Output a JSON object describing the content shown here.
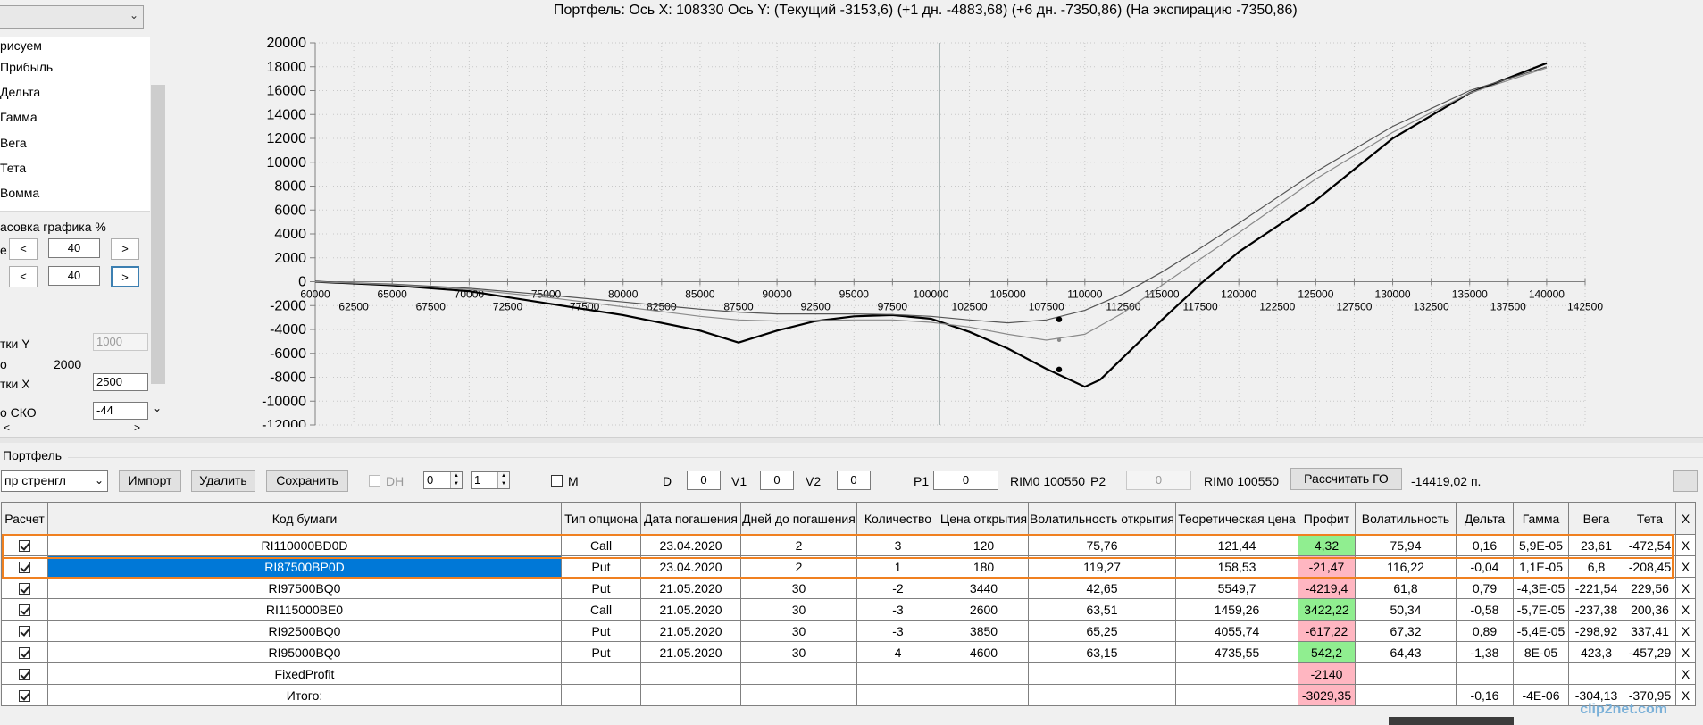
{
  "left_panel": {
    "dropdown_value": "",
    "items": [
      "рисуем",
      "Прибыль",
      "Дельта",
      "Гамма",
      "Вега",
      "Тета",
      "Вомма"
    ],
    "scale_title": "асовка графика %",
    "scale_row1_label": "е",
    "scale_row1_value": "40",
    "scale_row2_value": "40",
    "btn_dec": "<",
    "btn_inc": ">",
    "grid_y_label": "тки Y",
    "grid_y_value": "1000",
    "o_label": "о",
    "o_value": "2000",
    "grid_x_label": "тки X",
    "grid_x_value": "2500",
    "sko_label": "о СКО",
    "sko_value": "-44",
    "hscroll_left": "<",
    "hscroll_right": ">",
    "scroll_down": "⌄"
  },
  "chart": {
    "title": "Портфель: Ось X: 108330 Ось Y:  (Текущий -3153,6)  (+1 дн. -4883,68)  (+6 дн. -7350,86)  (На экспирацию -7350,86)"
  },
  "chart_data": {
    "type": "line",
    "title": "Портфель: Ось X: 108330 Ось Y:  (Текущий -3153,6)  (+1 дн. -4883,68)  (+6 дн. -7350,86)  (На экспирацию -7350,86)",
    "xlim": [
      60000,
      142500
    ],
    "ylim": [
      -12000,
      20000
    ],
    "x_ticks_upper": [
      60000,
      65000,
      70000,
      75000,
      80000,
      85000,
      90000,
      95000,
      100000,
      105000,
      110000,
      115000,
      120000,
      125000,
      130000,
      135000,
      140000
    ],
    "x_ticks_lower": [
      62500,
      67500,
      72500,
      77500,
      82500,
      87500,
      92500,
      97500,
      102500,
      107500,
      112500,
      117500,
      122500,
      127500,
      132500,
      137500,
      142500
    ],
    "y_ticks": [
      20000,
      18000,
      16000,
      14000,
      12000,
      10000,
      8000,
      6000,
      4000,
      2000,
      0,
      -2000,
      -4000,
      -6000,
      -8000,
      -10000,
      -12000
    ],
    "vertical_line_x": 100550,
    "grid": true,
    "series": [
      {
        "color": "#000000",
        "width": 2.2,
        "x": [
          60000,
          65000,
          70000,
          75000,
          80000,
          85000,
          87500,
          90000,
          92500,
          95000,
          97500,
          100000,
          102500,
          105000,
          107500,
          110000,
          111000,
          115000,
          117500,
          120000,
          125000,
          130000,
          135000,
          140000
        ],
        "y": [
          0,
          -300,
          -800,
          -1800,
          -2800,
          -4100,
          -5100,
          -4100,
          -3300,
          -2900,
          -2800,
          -3100,
          -4200,
          -5600,
          -7300,
          -8800,
          -8200,
          -3200,
          -200,
          2500,
          6800,
          12000,
          15800,
          18300
        ]
      },
      {
        "color": "#555555",
        "width": 1.2,
        "x": [
          60000,
          65000,
          70000,
          75000,
          80000,
          85000,
          87500,
          90000,
          92500,
          95000,
          97500,
          100000,
          102500,
          105000,
          107500,
          110000,
          112500,
          115000,
          117500,
          120000,
          125000,
          130000,
          135000,
          140000
        ],
        "y": [
          0,
          -200,
          -550,
          -1100,
          -1700,
          -2300,
          -2550,
          -2700,
          -2700,
          -2700,
          -2750,
          -2900,
          -3200,
          -3450,
          -3200,
          -2400,
          -1000,
          800,
          2800,
          4900,
          9200,
          13000,
          16000,
          18000
        ]
      },
      {
        "color": "#8a8a8a",
        "width": 1.2,
        "x": [
          60000,
          65000,
          70000,
          75000,
          80000,
          85000,
          87500,
          90000,
          92500,
          95000,
          97500,
          100000,
          102500,
          105000,
          107500,
          110000,
          112500,
          115000,
          117500,
          120000,
          125000,
          130000,
          135000,
          140000
        ],
        "y": [
          0,
          -250,
          -650,
          -1300,
          -2100,
          -2900,
          -3200,
          -3300,
          -3250,
          -3200,
          -3200,
          -3400,
          -3800,
          -4400,
          -4900,
          -4400,
          -2600,
          -300,
          1900,
          4100,
          8600,
          12500,
          15800,
          17900
        ]
      }
    ],
    "markers": [
      {
        "x": 108330,
        "y": -3153.6
      },
      {
        "x": 108330,
        "y": -4883.68
      },
      {
        "x": 108330,
        "y": -7350.86
      }
    ]
  },
  "portfolio": {
    "group_label": "Портфель",
    "strategy_dropdown": "пр стренгл",
    "import_btn": "Импорт",
    "delete_btn": "Удалить",
    "save_btn": "Сохранить",
    "dh_label": "DH",
    "spin1": "0",
    "spin2": "1",
    "m_label": "M",
    "d_label": "D",
    "d_value": "0",
    "v1_label": "V1",
    "v1_value": "0",
    "v2_label": "V2",
    "v2_value": "0",
    "p1_label": "P1",
    "p1_value": "0",
    "rim1_label": "RIM0 100550",
    "p2_label": "P2",
    "p2_value": "0",
    "rim2_label": "RIM0 100550",
    "calc_go_btn": "Рассчитать ГО",
    "go_value": "-14419,02 п.",
    "minimize_btn": "_"
  },
  "table": {
    "headers": [
      "Расчет",
      "Код бумаги",
      "Тип опциона",
      "Дата погашения",
      "Дней до погашения",
      "Количество",
      "Цена открытия",
      "Волатильность открытия",
      "Теоретическая цена",
      "Профит",
      "Волатильность",
      "Дельта",
      "Гамма",
      "Вега",
      "Тета",
      "X"
    ],
    "rows": [
      {
        "code": "RI110000BD0D",
        "type": "Call",
        "date": "23.04.2020",
        "days": "2",
        "qty": "3",
        "price": "120",
        "vol_open": "75,76",
        "theo": "121,44",
        "profit": "4,32",
        "profit_sign": "pos",
        "vol": "75,94",
        "delta": "0,16",
        "gamma": "5,9E-05",
        "vega": "23,61",
        "theta": "-472,54",
        "x": "X"
      },
      {
        "code": "RI87500BP0D",
        "type": "Put",
        "date": "23.04.2020",
        "days": "2",
        "qty": "1",
        "price": "180",
        "vol_open": "119,27",
        "theo": "158,53",
        "profit": "-21,47",
        "profit_sign": "neg",
        "vol": "116,22",
        "delta": "-0,04",
        "gamma": "1,1E-05",
        "vega": "6,8",
        "theta": "-208,45",
        "x": "X",
        "selected": true
      },
      {
        "code": "RI97500BQ0",
        "type": "Put",
        "date": "21.05.2020",
        "days": "30",
        "qty": "-2",
        "price": "3440",
        "vol_open": "42,65",
        "theo": "5549,7",
        "profit": "-4219,4",
        "profit_sign": "neg",
        "vol": "61,8",
        "delta": "0,79",
        "gamma": "-4,3E-05",
        "vega": "-221,54",
        "theta": "229,56",
        "x": "X"
      },
      {
        "code": "RI115000BE0",
        "type": "Call",
        "date": "21.05.2020",
        "days": "30",
        "qty": "-3",
        "price": "2600",
        "vol_open": "63,51",
        "theo": "1459,26",
        "profit": "3422,22",
        "profit_sign": "pos",
        "vol": "50,34",
        "delta": "-0,58",
        "gamma": "-5,7E-05",
        "vega": "-237,38",
        "theta": "200,36",
        "x": "X"
      },
      {
        "code": "RI92500BQ0",
        "type": "Put",
        "date": "21.05.2020",
        "days": "30",
        "qty": "-3",
        "price": "3850",
        "vol_open": "65,25",
        "theo": "4055,74",
        "profit": "-617,22",
        "profit_sign": "neg",
        "vol": "67,32",
        "delta": "0,89",
        "gamma": "-5,4E-05",
        "vega": "-298,92",
        "theta": "337,41",
        "x": "X"
      },
      {
        "code": "RI95000BQ0",
        "type": "Put",
        "date": "21.05.2020",
        "days": "30",
        "qty": "4",
        "price": "4600",
        "vol_open": "63,15",
        "theo": "4735,55",
        "profit": "542,2",
        "profit_sign": "pos",
        "vol": "64,43",
        "delta": "-1,38",
        "gamma": "8E-05",
        "vega": "423,3",
        "theta": "-457,29",
        "x": "X"
      },
      {
        "code": "FixedProfit",
        "type": "",
        "date": "",
        "days": "",
        "qty": "",
        "price": "",
        "vol_open": "",
        "theo": "",
        "profit": "-2140",
        "profit_sign": "neg",
        "vol": "",
        "delta": "",
        "gamma": "",
        "vega": "",
        "theta": "",
        "x": "X"
      },
      {
        "code": "Итого:",
        "type": "",
        "date": "",
        "days": "",
        "qty": "",
        "price": "",
        "vol_open": "",
        "theo": "",
        "profit": "-3029,35",
        "profit_sign": "neg",
        "vol": "",
        "delta": "-0,16",
        "gamma": "-4E-06",
        "vega": "-304,13",
        "theta": "-370,95",
        "x": "X"
      }
    ]
  },
  "watermark": "clip2net.com",
  "colors": {
    "positive": "#90ee90",
    "negative": "#ffb6c1",
    "selected": "#0078d7",
    "highlight": "#f08020"
  }
}
